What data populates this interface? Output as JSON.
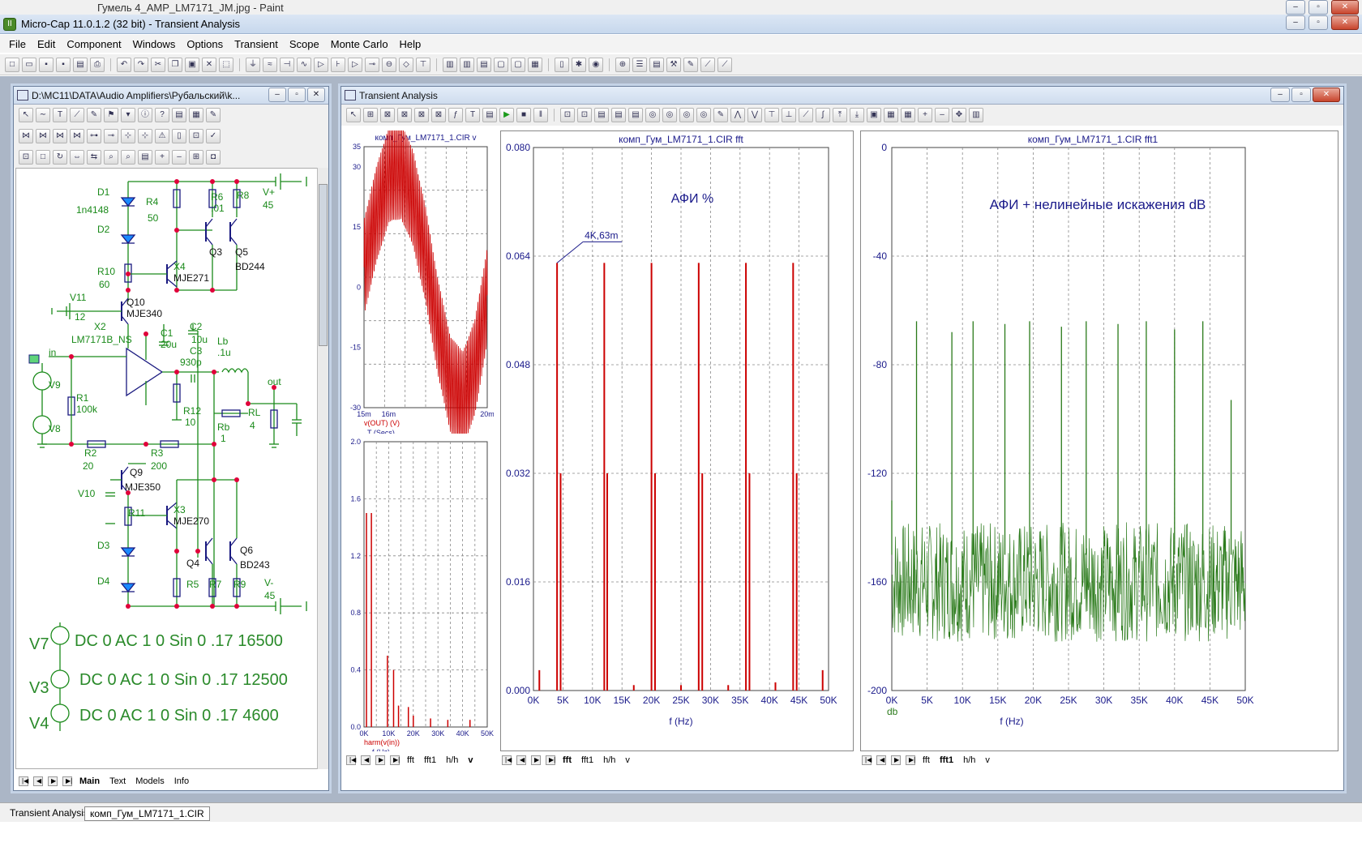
{
  "paint_title": "Гумель 4_AMP_LM7171_JM.jpg - Paint",
  "app_title": "Micro-Cap 11.0.1.2 (32 bit) - Transient Analysis",
  "menu": [
    "File",
    "Edit",
    "Component",
    "Windows",
    "Options",
    "Transient",
    "Scope",
    "Monte Carlo",
    "Help"
  ],
  "schematic": {
    "title": "D:\\MC11\\DATA\\Audio Amplifiers\\Рубальский\\k...",
    "tabs": [
      "Main",
      "Text",
      "Models",
      "Info"
    ],
    "labels": [
      "D1",
      "1n4148",
      "D2",
      "R4",
      "50",
      "R6",
      ".01",
      "R8",
      "V+",
      "45",
      "Q3",
      "Q5",
      "BD244",
      "R10",
      "60",
      "X4",
      "MJE271",
      "V11",
      "12",
      "Q10",
      "MJE340",
      "X2",
      "LM7171B_NS",
      "C1",
      "20u",
      "C2",
      "10u",
      "C3",
      "930p",
      "Lb",
      ".1u",
      "in",
      "out",
      "V9",
      "R1",
      "100k",
      "V8",
      "R12",
      "10",
      "RL",
      "4",
      "Rb",
      "1",
      "R2",
      "20",
      "R3",
      "200",
      "Q9",
      "MJE350",
      "V10",
      "R11",
      "X3",
      "MJE270",
      "D3",
      "D4",
      "Q4",
      "Q6",
      "BD243",
      "R5",
      "R7",
      "R9",
      "V-",
      "45"
    ],
    "sources": [
      {
        "name": "V7",
        "text": "DC 0 AC 1 0 Sin 0 .17 16500"
      },
      {
        "name": "V3",
        "text": "DC 0 AC 1 0 Sin 0 .17 12500"
      },
      {
        "name": "V4",
        "text": "DC 0 AC 1 0 Sin 0 .17 4600"
      }
    ]
  },
  "analysis_window": {
    "title": "Transient Analysis",
    "tabs_small": [
      "fft",
      "fft1",
      "h/h",
      "v"
    ],
    "tabs_mid": [
      "fft",
      "fft1",
      "h/h",
      "v"
    ],
    "tabs_right": [
      "fft",
      "fft1",
      "h/h",
      "v"
    ]
  },
  "chart_data": [
    {
      "type": "line",
      "title": "комп_Гум_LM7171_1.CIR v",
      "xlabel": "T (Secs)",
      "ylabel": "v(OUT) (V)",
      "x_ticks": [
        "15m",
        "16m",
        "20m"
      ],
      "y_ticks": [
        "35",
        "30",
        "15",
        "0",
        "-15",
        "-30"
      ],
      "xlim": [
        15,
        20
      ],
      "ylim": [
        -30,
        35
      ],
      "series": [
        {
          "name": "v(OUT) (V)",
          "color": "#cc0000",
          "description": "carrier ~16.5kHz amplitude-modulated by 4.6kHz component, peak ~29V"
        }
      ],
      "envelope_points": [
        [
          15.0,
          5
        ],
        [
          15.5,
          18
        ],
        [
          16.0,
          28
        ],
        [
          16.5,
          29
        ],
        [
          17.0,
          22
        ],
        [
          17.5,
          8
        ],
        [
          18.0,
          -10
        ],
        [
          18.5,
          -24
        ],
        [
          19.0,
          -28
        ],
        [
          19.5,
          -20
        ],
        [
          20.0,
          -2
        ]
      ]
    },
    {
      "type": "bar",
      "title": "",
      "xlabel": "f (Hz)",
      "ylabel": "harm(v(in))",
      "x_ticks": [
        "0K",
        "10K",
        "20K",
        "30K",
        "40K",
        "50K"
      ],
      "y_ticks": [
        "2.0",
        "1.6",
        "1.2",
        "0.8",
        "0.4",
        "0.0"
      ],
      "xlim": [
        0,
        50
      ],
      "ylim": [
        0,
        2.0
      ],
      "bars": [
        [
          1,
          1.5
        ],
        [
          3,
          1.5
        ],
        [
          9.5,
          0.5
        ],
        [
          12,
          0.4
        ],
        [
          14,
          0.15
        ],
        [
          18,
          0.14
        ],
        [
          20,
          0.08
        ],
        [
          27,
          0.06
        ],
        [
          34,
          0.05
        ],
        [
          43,
          0.05
        ]
      ]
    },
    {
      "type": "bar",
      "title": "комп_Гум_LM7171_1.CIR fft",
      "annotation": "АФИ %",
      "marker_label": "4K,63m",
      "xlabel": "f (Hz)",
      "x_ticks": [
        "0K",
        "5K",
        "10K",
        "15K",
        "20K",
        "25K",
        "30K",
        "35K",
        "40K",
        "45K",
        "50K"
      ],
      "y_ticks": [
        "0.080",
        "0.064",
        "0.048",
        "0.032",
        "0.016",
        "0.000"
      ],
      "xlim": [
        0,
        50
      ],
      "ylim": [
        0,
        0.08
      ],
      "bars_kHz": [
        [
          4.0,
          0.063
        ],
        [
          4.6,
          0.032
        ],
        [
          12.0,
          0.063
        ],
        [
          12.5,
          0.032
        ],
        [
          20.0,
          0.063
        ],
        [
          20.6,
          0.032
        ],
        [
          28.0,
          0.063
        ],
        [
          28.6,
          0.032
        ],
        [
          36.0,
          0.063
        ],
        [
          36.6,
          0.032
        ],
        [
          44.0,
          0.063
        ],
        [
          44.6,
          0.032
        ],
        [
          1.0,
          0.003
        ],
        [
          17.0,
          0.0008
        ],
        [
          25.0,
          0.0008
        ],
        [
          33.0,
          0.0008
        ],
        [
          41.0,
          0.0012
        ],
        [
          49.0,
          0.003
        ]
      ]
    },
    {
      "type": "line",
      "title": "комп_Гум_LM7171_1.CIR fft1",
      "annotation": "АФИ + нелинейные искажения dB",
      "xlabel": "f (Hz)",
      "ylabel": "db",
      "x_ticks": [
        "0K",
        "5K",
        "10K",
        "15K",
        "20K",
        "25K",
        "30K",
        "35K",
        "40K",
        "45K",
        "50K"
      ],
      "y_ticks": [
        "0",
        "-40",
        "-80",
        "-120",
        "-160",
        "-200"
      ],
      "xlim": [
        0,
        50
      ],
      "ylim": [
        -200,
        0
      ],
      "noise_floor_db": -160,
      "peaks_kHz": [
        [
          0,
          -130
        ],
        [
          3.5,
          -64
        ],
        [
          8.5,
          -68
        ],
        [
          11.5,
          -64
        ],
        [
          16,
          -65
        ],
        [
          19.5,
          -64
        ],
        [
          24,
          -66
        ],
        [
          27.5,
          -64
        ],
        [
          32,
          -65
        ],
        [
          36,
          -64
        ],
        [
          40,
          -67
        ],
        [
          44,
          -64
        ],
        [
          48,
          -93
        ]
      ],
      "series": [
        {
          "name": "",
          "color": "#2a7a1a"
        }
      ]
    }
  ],
  "taskbar": [
    "Transient Analysis",
    "комп_Гум_LM7171_1.CIR"
  ]
}
